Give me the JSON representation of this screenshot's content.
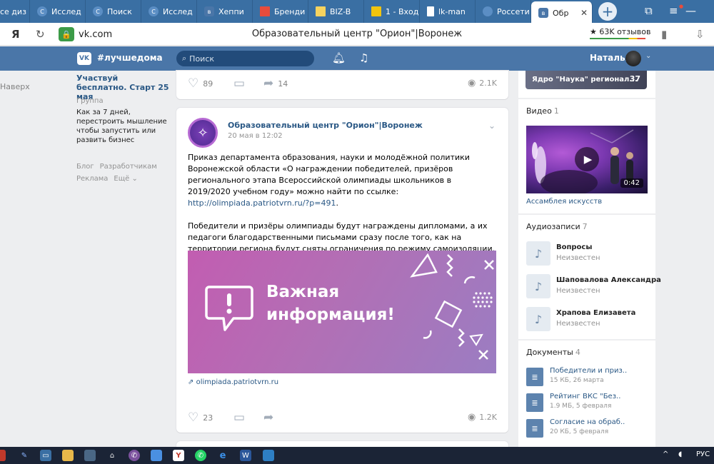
{
  "browser": {
    "tabs": [
      {
        "label": "се диз",
        "icon": "generic-icon",
        "active": false
      },
      {
        "label": "Исслед",
        "icon": "c-icon",
        "active": false
      },
      {
        "label": "Поиск",
        "icon": "c-icon",
        "active": false
      },
      {
        "label": "Исслед",
        "icon": "c-icon",
        "active": false
      },
      {
        "label": "Хеппи",
        "icon": "vk-icon",
        "active": false
      },
      {
        "label": "Бренди",
        "icon": "red-icon",
        "active": false
      },
      {
        "label": "BIZ-B",
        "icon": "bb-icon",
        "active": false
      },
      {
        "label": "1 - Вход",
        "icon": "mail-icon",
        "active": false
      },
      {
        "label": "lk-man",
        "icon": "doc-icon",
        "active": false
      },
      {
        "label": "Россети",
        "icon": "c-icon",
        "active": false
      },
      {
        "label": "Обр",
        "icon": "vk-icon",
        "active": true
      }
    ],
    "host": "vk.com",
    "page_title": "Образовательный центр \"Орион\"|Воронеж",
    "reviews": "63K отзывов"
  },
  "vk_header": {
    "logo": "VK",
    "hashtag": "#лучшедома",
    "search_placeholder": "Поиск",
    "user_name": "Наталья"
  },
  "left_nav": {
    "back_to_top": "Наверх",
    "promo": {
      "title": "Участвуй бесплатно. Старт 25 мая",
      "subtitle": "Группа",
      "text": "Как за 7 дней, перестроить мышление чтобы запустить или развить бизнес"
    },
    "links": [
      "Блог",
      "Разработчикам",
      "Реклама",
      "Ещё ⌄"
    ]
  },
  "feed": {
    "prev_post": {
      "likes": "89",
      "shares": "14",
      "views": "2.1K"
    },
    "post": {
      "author": "Образовательный центр \"Орион\"|Воронеж",
      "date": "20 мая в 12:02",
      "text_p1_a": "Приказ департамента образования, науки и молодёжной политики Воронежской области «О награждении победителей, призёров регионального этапа Всероссийской олимпиады школьников в 2019/2020 учебном году» можно найти по ссылке: ",
      "text_p1_link": "http://olimpiada.patriotvrn.ru/?p=491",
      "text_p1_b": ".",
      "text_p2": "Победители и призёры олимпиады будут награждены дипломами, а их педагоги благодарственными письмами сразу после того, как на территории региона будут сняты ограничения по режиму самоизоляции.",
      "banner_line1": "Важная",
      "banner_line2": "информация!",
      "link_host": "olimpiada.patriotvrn.ru",
      "likes": "23",
      "views": "1.2K"
    }
  },
  "right": {
    "nauka": {
      "label": "Ядро \"Наука\" регионал...",
      "count": "37"
    },
    "video": {
      "title": "Видео",
      "count": "1",
      "duration": "0:42",
      "caption": "Ассамблея искусств"
    },
    "audio": {
      "title": "Аудиозаписи",
      "count": "7",
      "items": [
        {
          "name": "Вопросы",
          "artist": "Неизвестен"
        },
        {
          "name": "Шаповалова Александра",
          "artist": "Неизвестен"
        },
        {
          "name": "Храпова Елизавета",
          "artist": "Неизвестен"
        }
      ]
    },
    "docs": {
      "title": "Документы",
      "count": "4",
      "items": [
        {
          "name": "Победители и приз..",
          "meta": "15 КБ, 26 марта"
        },
        {
          "name": "Рейтинг ВКС \"Без..",
          "meta": "1.9 МБ, 5 февраля"
        },
        {
          "name": "Согласие на обраб..",
          "meta": "20 КБ, 5 февраля"
        }
      ]
    }
  },
  "taskbar": {
    "lang": "РУС",
    "chevron": "^"
  }
}
